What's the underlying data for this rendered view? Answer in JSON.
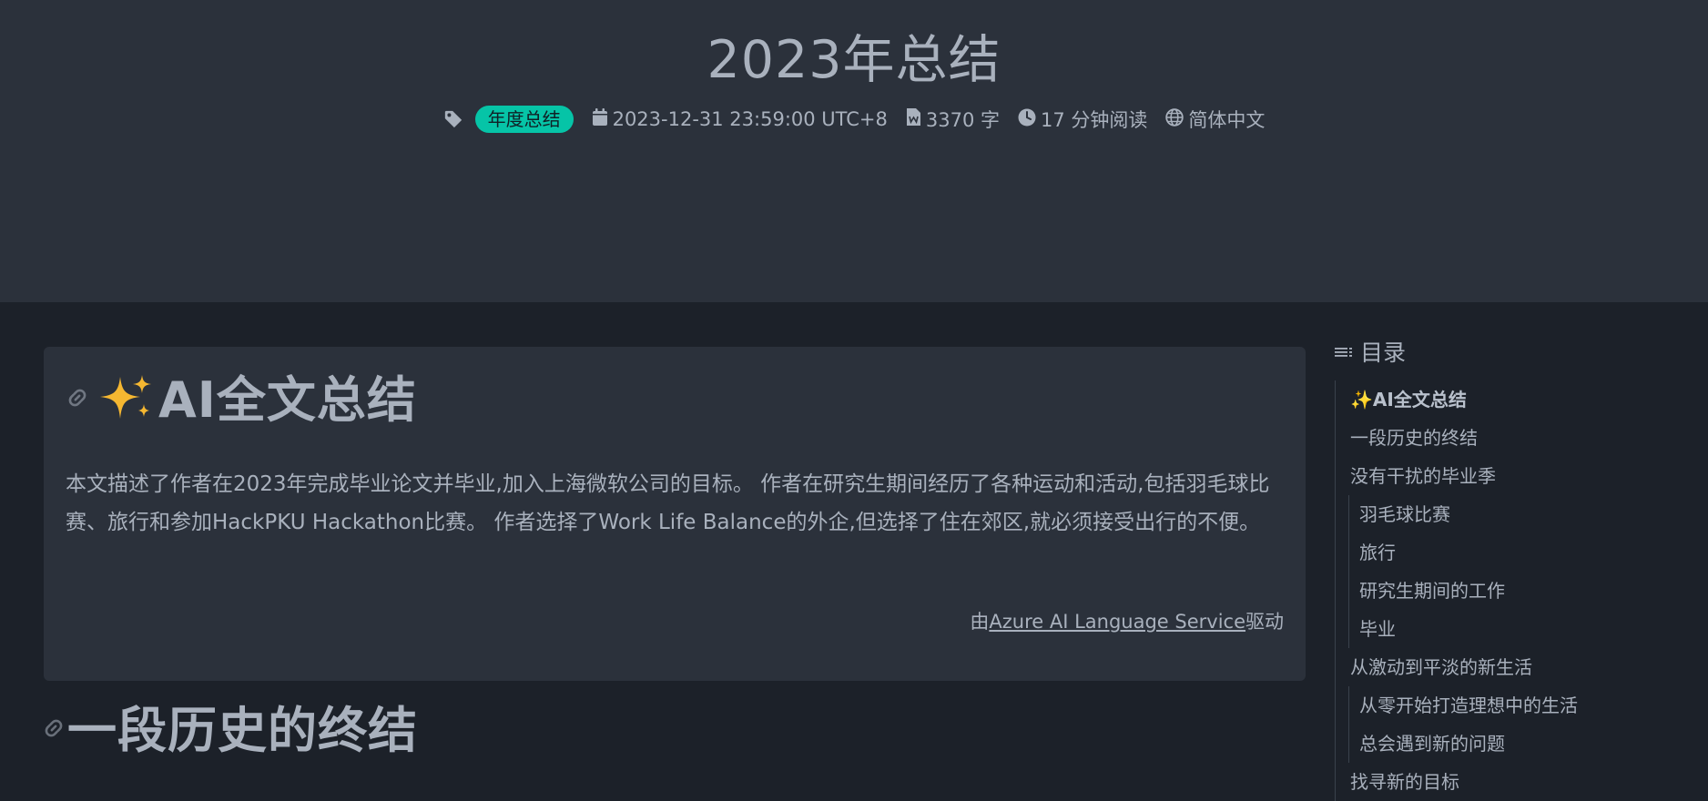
{
  "post": {
    "title": "2023年总结",
    "tag": "年度总结",
    "date": "2023-12-31 23:59:00 UTC+8",
    "words": "3370 字",
    "reading_time": "17 分钟阅读",
    "language": "简体中文"
  },
  "ai_summary": {
    "heading": "AI全文总结",
    "text": "本文描述了作者在2023年完成毕业论文并毕业,加入上海微软公司的目标。 作者在研究生期间经历了各种运动和活动,包括羽毛球比赛、旅行和参加HackPKU Hackathon比赛。 作者选择了Work Life Balance的外企,但选择了住在郊区,就必须接受出行的不便。",
    "powered_prefix": "由",
    "powered_link": "Azure AI Language Service",
    "powered_suffix": "驱动"
  },
  "section": {
    "heading": "一段历史的终结"
  },
  "toc": {
    "title": "目录",
    "items": [
      {
        "label": "✨AI全文总结"
      },
      {
        "label": "一段历史的终结"
      },
      {
        "label": "没有干扰的毕业季"
      },
      {
        "label": "羽毛球比赛"
      },
      {
        "label": "旅行"
      },
      {
        "label": "研究生期间的工作"
      },
      {
        "label": "毕业"
      },
      {
        "label": "从激动到平淡的新生活"
      },
      {
        "label": "从零开始打造理想中的生活"
      },
      {
        "label": "总会遇到新的问题"
      },
      {
        "label": "找寻新的目标"
      }
    ]
  },
  "colors": {
    "header_bg": "#2b313b",
    "page_bg": "#1c2129",
    "tag_badge": "#06c4a7",
    "text": "#a9b1bd"
  }
}
